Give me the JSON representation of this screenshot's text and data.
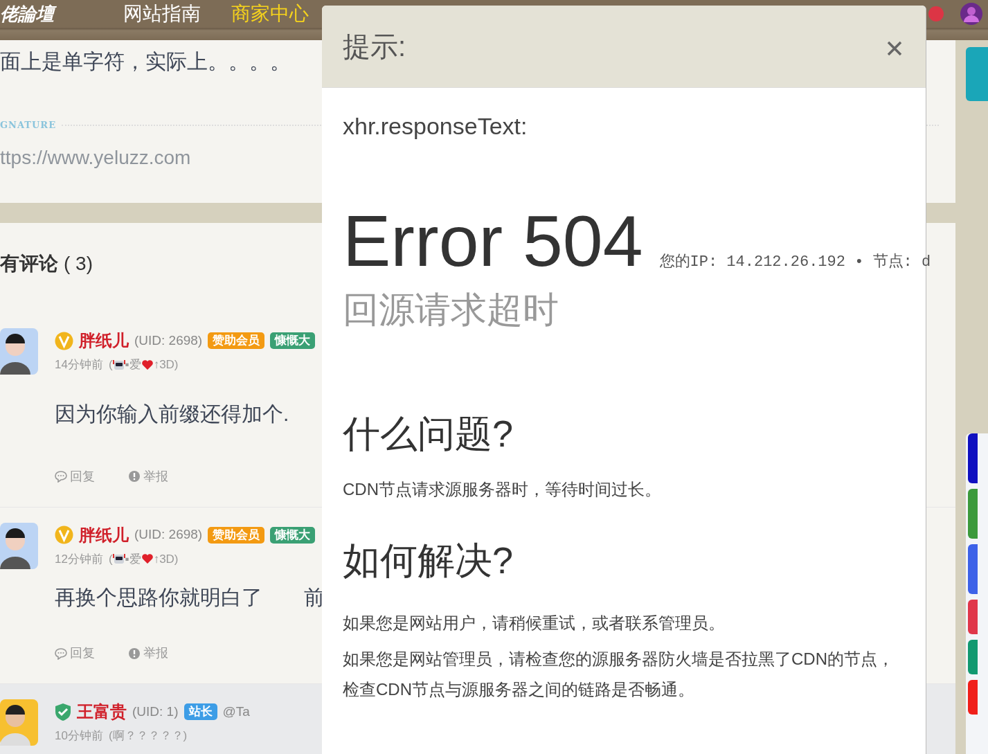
{
  "header": {
    "logo": "佬論壇",
    "nav": [
      {
        "label": "网站指南",
        "selected": false
      },
      {
        "label": "商家中心",
        "selected": true
      }
    ]
  },
  "post": {
    "text": "面上是单字符，实际上。。。。",
    "signature_label": "GNATURE",
    "signature": "ttps://www.yeluzz.com"
  },
  "comments_section": {
    "title": "有评论",
    "count": "( 3)"
  },
  "comments": [
    {
      "kind": "vip",
      "highlighted": false,
      "name": "胖纸儿",
      "uid": "(UID: 2698)",
      "badges": [
        {
          "label": "赞助会员",
          "color": "#f39a12"
        },
        {
          "label": "慷慨大",
          "color": "#3aa074"
        }
      ],
      "time": "14分钟前",
      "status": {
        "prefix": "(",
        "middle": "▪爱",
        "suffix": "↑3D)"
      },
      "text": "因为你输入前缀还得加个.",
      "actions": [
        "回复",
        "举报"
      ]
    },
    {
      "kind": "vip",
      "highlighted": false,
      "name": "胖纸儿",
      "uid": "(UID: 2698)",
      "badges": [
        {
          "label": "赞助会员",
          "color": "#f39a12"
        },
        {
          "label": "慷慨大",
          "color": "#3aa074"
        }
      ],
      "time": "12分钟前",
      "status": {
        "prefix": "(",
        "middle": "▪爱",
        "suffix": "↑3D)"
      },
      "text": "再换个思路你就明白了　　前",
      "actions": [
        "回复",
        "举报"
      ]
    },
    {
      "kind": "admin",
      "highlighted": true,
      "name": "王富贵",
      "uid": "(UID: 1)",
      "badges": [
        {
          "label": "站长",
          "color": "#3d9de6"
        }
      ],
      "mention": "@Ta",
      "time": "10分钟前",
      "note": "(啊？？？？？)"
    }
  ],
  "rail": {
    "buttons": [
      {
        "color": "#1010c0"
      },
      {
        "color": "#3c9a3c"
      },
      {
        "color": "#3d62e8"
      },
      {
        "color": "#e0374a"
      },
      {
        "color": "#129970"
      },
      {
        "color": "#f0201a"
      }
    ]
  },
  "dialog": {
    "title": "提示:",
    "response_label": "xhr.responseText:",
    "error": "Error 504",
    "ip_line": "您的IP: 14.212.26.192 • 节点: d",
    "subtitle": "回源请求超时",
    "sections": [
      {
        "heading": "什么问题?",
        "paragraphs": [
          "CDN节点请求源服务器时，等待时间过长。"
        ]
      },
      {
        "heading": "如何解决?",
        "paragraphs": [
          "如果您是网站用户，请稍候重试，或者联系管理员。",
          "如果您是网站管理员，请检查您的源服务器防火墙是否拉黑了CDN的节点，检查CDN节点与源服务器之间的链路是否畅通。"
        ]
      }
    ]
  }
}
